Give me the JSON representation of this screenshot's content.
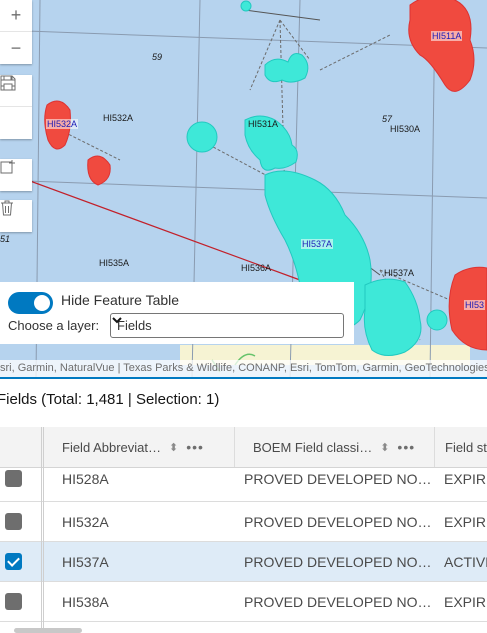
{
  "map": {
    "labels": {
      "hi511a": "HI511A",
      "hi532a_blue": "HI532A",
      "hi532a": "HI532A",
      "hi531a": "HI531A",
      "hi530a": "HI530A",
      "hi537a_blue": "HI537A",
      "hi537a": "HI537A",
      "hi535a": "HI535A",
      "hi536a": "HI536A",
      "hi53_blue": "HI53",
      "block59": "59",
      "block57": "57",
      "block51": "51"
    },
    "colors": {
      "selected": "#3ee8d8",
      "field": "#f04a3f",
      "water": "#b6d3ee"
    },
    "attribution": "sri, Garmin, NaturalVue | Texas Parks & Wildlife, CONANP, Esri, TomTom, Garmin, GeoTechnologies"
  },
  "toolbar": {
    "zoom_in": "+",
    "zoom_out": "−",
    "icons": [
      "plus-icon",
      "minus-icon",
      "print-icon",
      "save-icon",
      "add-layer-icon",
      "trash-icon"
    ]
  },
  "panel": {
    "toggle_label": "Hide Feature Table",
    "toggle_on": true,
    "choose_label": "Choose a layer:",
    "selected_layer": "Fields"
  },
  "feature_table": {
    "title": "Fields (Total: 1,481 | Selection: 1)",
    "columns": [
      "Field Abbreviat…",
      "BOEM Field classi…",
      "Field st"
    ],
    "rows": [
      {
        "abbr": "HI528A",
        "class": "PROVED DEVELOPED NO…",
        "status": "EXPIRE",
        "selected": false
      },
      {
        "abbr": "HI532A",
        "class": "PROVED DEVELOPED NO…",
        "status": "EXPIRE",
        "selected": false
      },
      {
        "abbr": "HI537A",
        "class": "PROVED DEVELOPED NO…",
        "status": "ACTIVE",
        "selected": true
      },
      {
        "abbr": "HI538A",
        "class": "PROVED DEVELOPED NO…",
        "status": "EXPIRE",
        "selected": false
      }
    ]
  }
}
